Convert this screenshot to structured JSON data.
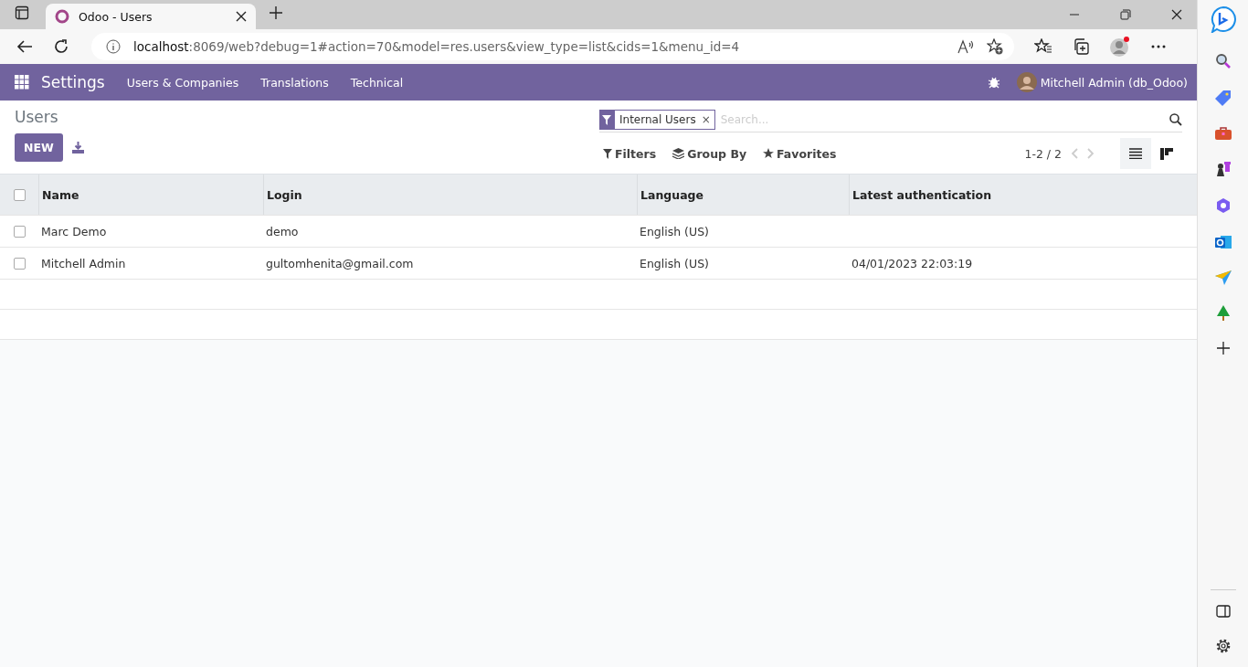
{
  "browser": {
    "tab_title": "Odoo - Users",
    "url_host": "localhost",
    "url_path": ":8069/web?debug=1#action=70&model=res.users&view_type=list&cids=1&menu_id=4"
  },
  "navbar": {
    "app_name": "Settings",
    "menu": [
      "Users & Companies",
      "Translations",
      "Technical"
    ],
    "user": "Mitchell Admin (db_Odoo)"
  },
  "control_panel": {
    "title": "Users",
    "new_button": "NEW",
    "search": {
      "facet": "Internal Users",
      "facet_remove": "×",
      "placeholder": "Search..."
    },
    "search_options": [
      {
        "kind": "filter",
        "label": "Filters"
      },
      {
        "kind": "group",
        "label": "Group By"
      },
      {
        "kind": "favorite",
        "label": "Favorites"
      }
    ],
    "pager": "1-2 / 2",
    "views": [
      {
        "kind": "list",
        "selected": true
      },
      {
        "kind": "kanban",
        "selected": false
      }
    ]
  },
  "table": {
    "select_all": {
      "checked": false
    },
    "columns": [
      "Name",
      "Login",
      "Language",
      "Latest authentication"
    ],
    "rows": [
      {
        "checked": false,
        "cells": [
          "Marc Demo",
          "demo",
          "English (US)",
          ""
        ]
      },
      {
        "checked": false,
        "cells": [
          "Mitchell Admin",
          "gultomhenita@gmail.com",
          "English (US)",
          "04/01/2023 22:03:19"
        ]
      }
    ]
  }
}
